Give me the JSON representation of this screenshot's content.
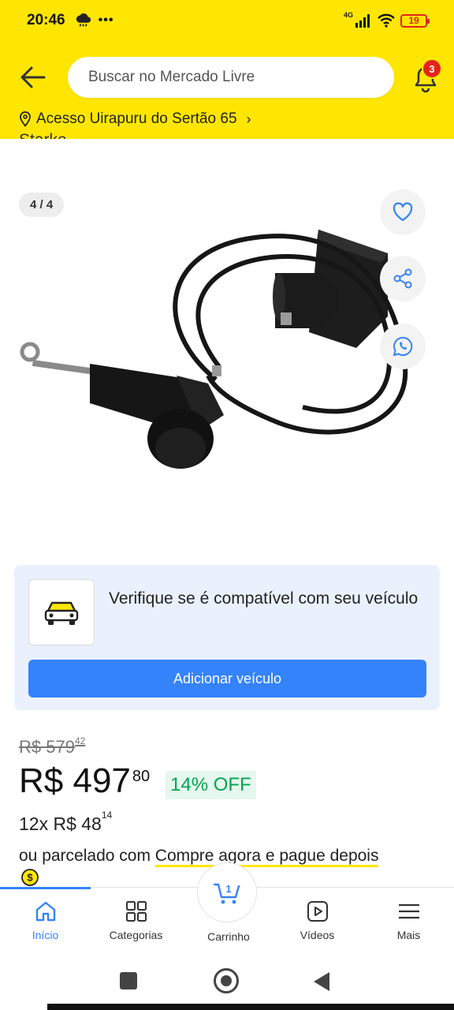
{
  "status_bar": {
    "time": "20:46",
    "dots": "•••",
    "network": "4G",
    "battery": "19"
  },
  "header": {
    "search_placeholder": "Buscar no Mercado Livre",
    "notification_count": "3",
    "address": "Acesso Uirapuru do Sertão 65",
    "address_chevron": "›"
  },
  "product": {
    "title_fragment": "Starke",
    "gallery_counter": "4 / 4"
  },
  "compat": {
    "text": "Verifique se é compatível com seu veículo",
    "button": "Adicionar veículo"
  },
  "pricing": {
    "old_price": "R$ 579",
    "old_cents": "42",
    "price": "R$ 497",
    "price_cents": "80",
    "discount": "14% OFF",
    "installments": "12x R$ 48",
    "installments_cents": "14",
    "financing_prefix": "ou parcelado com",
    "financing_link": "Compre agora e pague depois"
  },
  "tabs": {
    "home": "Início",
    "categories": "Categorias",
    "cart": "Carrinho",
    "cart_count": "1",
    "videos": "Vídeos",
    "more": "Mais"
  },
  "colors": {
    "brand_yellow": "#ffe600",
    "accent_blue": "#3483fa",
    "success_green": "#00a650",
    "badge_red": "#e0241b"
  }
}
